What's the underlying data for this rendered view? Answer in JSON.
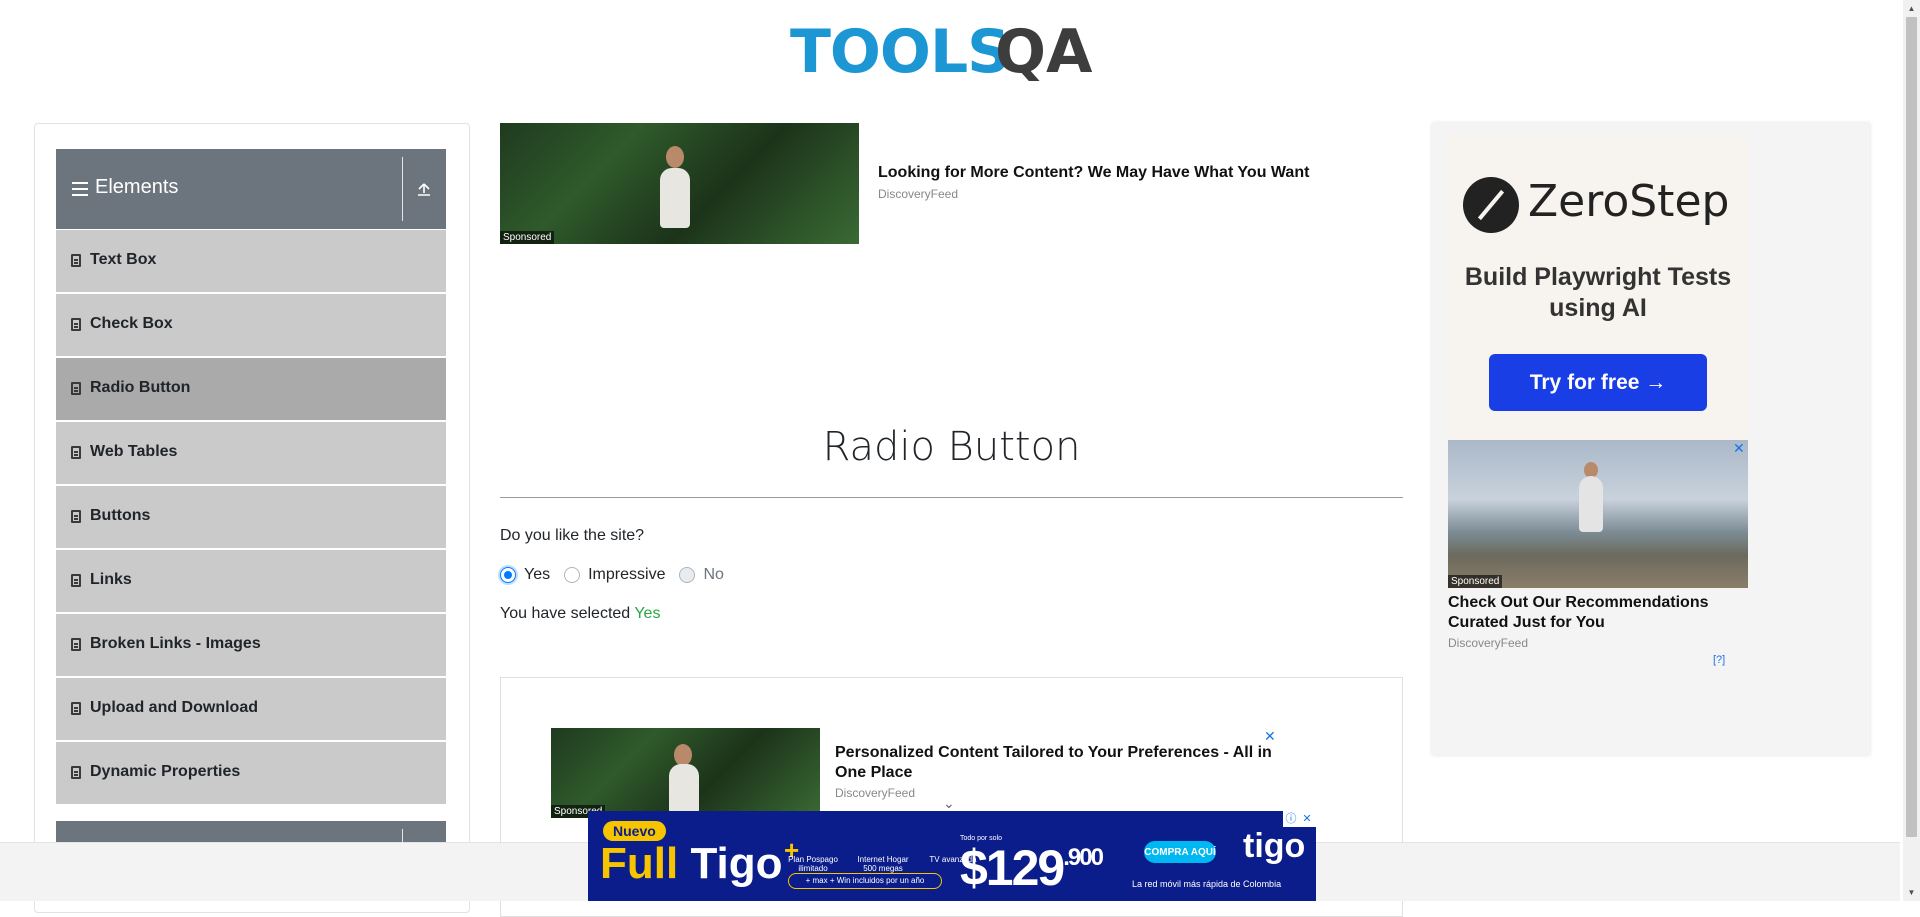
{
  "header": {
    "logo_tools": "TOOLS",
    "logo_qa": "QA"
  },
  "sidebar": {
    "group_title": "Elements",
    "items": [
      {
        "label": "Text Box"
      },
      {
        "label": "Check Box"
      },
      {
        "label": "Radio Button",
        "active": true
      },
      {
        "label": "Web Tables"
      },
      {
        "label": "Buttons"
      },
      {
        "label": "Links"
      },
      {
        "label": "Broken Links - Images"
      },
      {
        "label": "Upload and Download"
      },
      {
        "label": "Dynamic Properties"
      }
    ]
  },
  "top_ad": {
    "title": "Looking for More Content? We May Have What You Want",
    "source": "DiscoveryFeed",
    "sponsored": "Sponsored"
  },
  "main": {
    "title": "Radio Button",
    "question": "Do you like the site?",
    "options": [
      {
        "label": "Yes",
        "checked": true,
        "disabled": false
      },
      {
        "label": "Impressive",
        "checked": false,
        "disabled": false
      },
      {
        "label": "No",
        "checked": false,
        "disabled": true
      }
    ],
    "result_prefix": "You have selected ",
    "result_value": "Yes"
  },
  "content_ad": {
    "title": "Personalized Content Tailored to Your Preferences - All in One Place",
    "source": "DiscoveryFeed",
    "sponsored": "Sponsored",
    "close": "✕",
    "chevron": "⌄"
  },
  "right_ad": {
    "brand": "ZeroStep",
    "tagline": "Build Playwright Tests using AI",
    "cta": "Try for free →",
    "sponsored": "Sponsored",
    "promo_title": "Check Out Our Recommendations Curated Just for You",
    "promo_source": "DiscoveryFeed",
    "adchoice": "[?]",
    "close": "✕"
  },
  "footer_ad": {
    "badge": "Nuevo",
    "full": "Full",
    "tigo_word": "Tigo",
    "plus": "+",
    "feature_1": "Plan Pospago ilimitado",
    "feature_2": "Internet Hogar 500 megas",
    "feature_3": "TV avanzada",
    "pill": "+ max + Win incluidos por un año",
    "desde": "Todo por solo",
    "price": "$129",
    "price_cents": ".900",
    "cta": "COMPRA AQUÍ",
    "brand": "tigo",
    "slogan": "La red móvil más rápida de Colombia",
    "controls_info": "ⓘ",
    "controls_close": "✕"
  },
  "colors": {
    "accent_blue": "#007bff",
    "selected_green": "#28a745",
    "sidebar_header": "#6c757d",
    "menu_item": "#cacaca",
    "menu_item_active": "#aaaaaa",
    "logo_blue": "#1c97d4"
  }
}
